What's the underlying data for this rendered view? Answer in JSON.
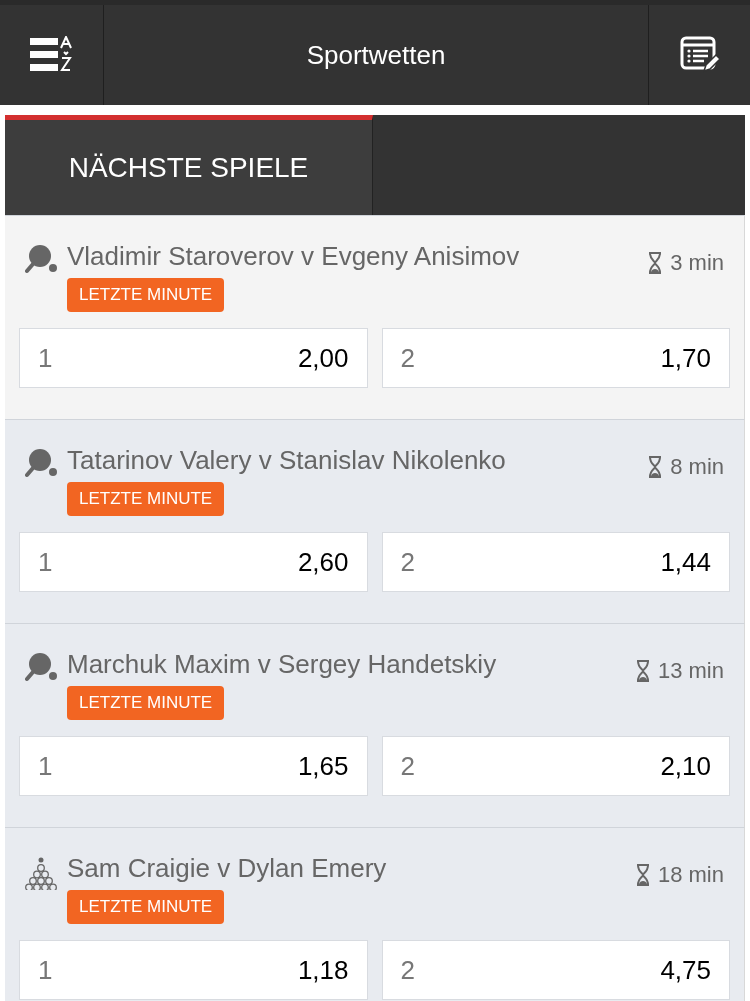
{
  "header": {
    "title": "Sportwetten"
  },
  "tabs": [
    {
      "label": "NÄCHSTE SPIELE",
      "selected": true
    }
  ],
  "events": [
    {
      "kind": "table-tennis",
      "name": "Vladimir Staroverov v Evgeny Anisimov",
      "badge": "LETZTE MINUTE",
      "time": "3 min",
      "odds": [
        {
          "label": "1",
          "value": "2,00"
        },
        {
          "label": "2",
          "value": "1,70"
        }
      ]
    },
    {
      "kind": "table-tennis",
      "name": "Tatarinov Valery v Stanislav Nikolenko",
      "badge": "LETZTE MINUTE",
      "time": "8 min",
      "odds": [
        {
          "label": "1",
          "value": "2,60"
        },
        {
          "label": "2",
          "value": "1,44"
        }
      ]
    },
    {
      "kind": "table-tennis",
      "name": "Marchuk Maxim v Sergey Handetskiy",
      "badge": "LETZTE MINUTE",
      "time": "13 min",
      "odds": [
        {
          "label": "1",
          "value": "1,65"
        },
        {
          "label": "2",
          "value": "2,10"
        }
      ]
    },
    {
      "kind": "snooker",
      "name": "Sam Craigie v Dylan Emery",
      "badge": "LETZTE MINUTE",
      "time": "18 min",
      "odds": [
        {
          "label": "1",
          "value": "1,18"
        },
        {
          "label": "2",
          "value": "4,75"
        }
      ]
    }
  ]
}
